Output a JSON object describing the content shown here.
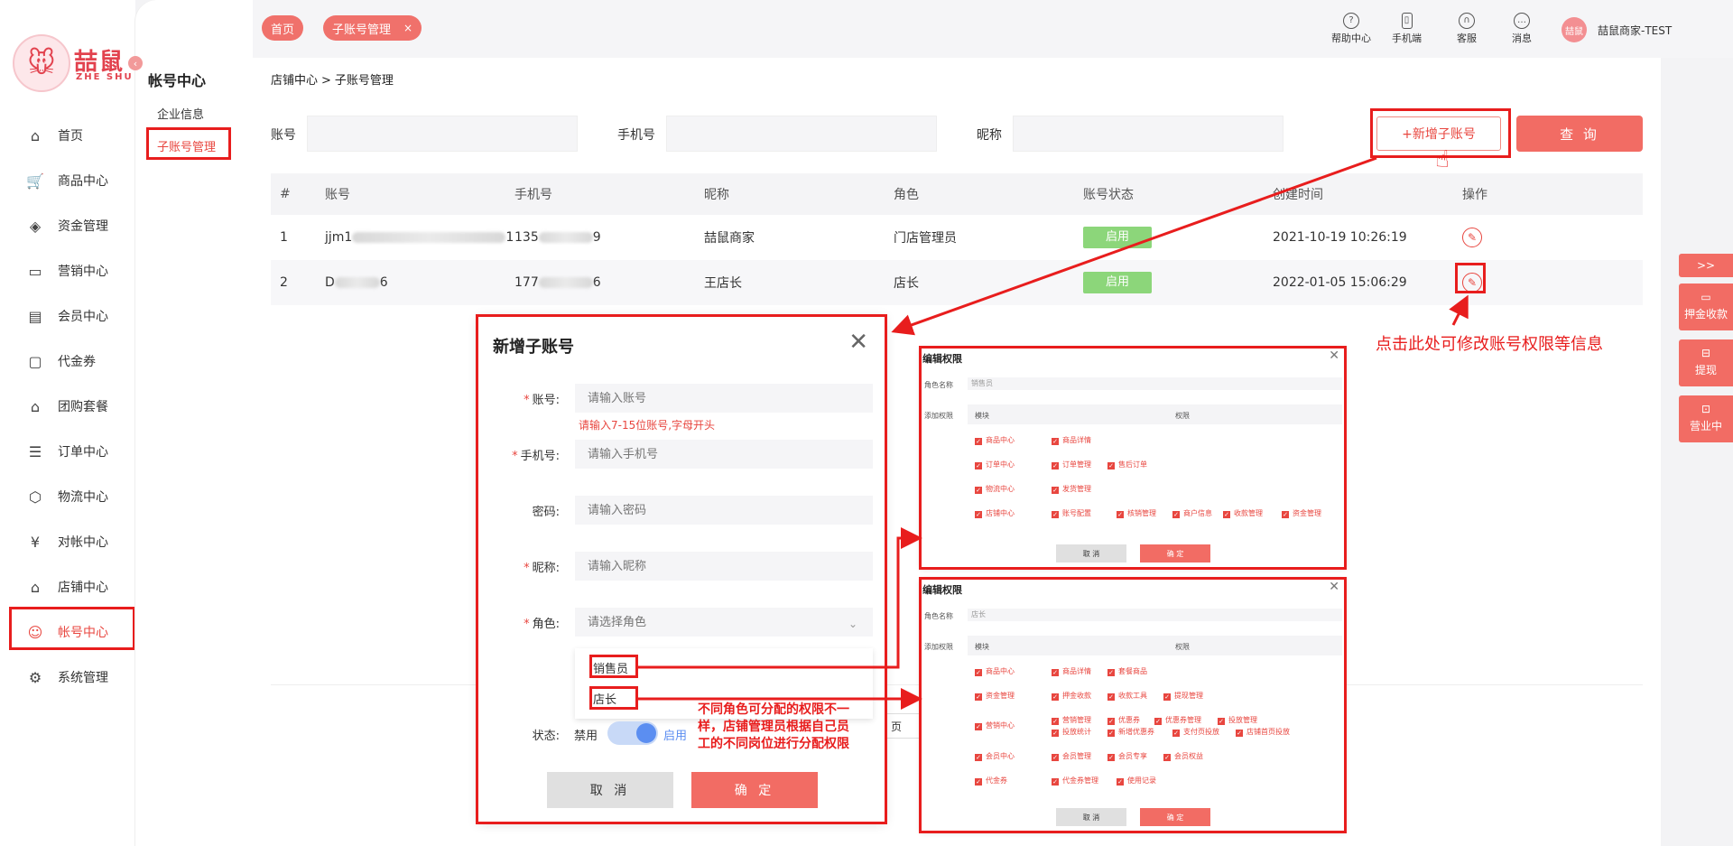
{
  "brand": {
    "logo_text": "喆鼠",
    "logo_sub": "ZHE SHU",
    "logo_icon": "mouse-mascot-icon"
  },
  "nav": [
    {
      "label": "首页",
      "icon": "home-icon"
    },
    {
      "label": "商品中心",
      "icon": "cart-icon"
    },
    {
      "label": "资金管理",
      "icon": "layers-icon"
    },
    {
      "label": "营销中心",
      "icon": "megaphone-icon"
    },
    {
      "label": "会员中心",
      "icon": "vip-card-icon"
    },
    {
      "label": "代金券",
      "icon": "coupon-icon"
    },
    {
      "label": "团购套餐",
      "icon": "tag-icon"
    },
    {
      "label": "订单中心",
      "icon": "order-icon"
    },
    {
      "label": "物流中心",
      "icon": "box-icon"
    },
    {
      "label": "对帐中心",
      "icon": "yen-icon"
    },
    {
      "label": "店铺中心",
      "icon": "store-icon"
    },
    {
      "label": "帐号中心",
      "icon": "user-icon"
    },
    {
      "label": "系统管理",
      "icon": "settings-icon"
    }
  ],
  "subnav": {
    "title": "帐号中心",
    "items": [
      "企业信息",
      "子账号管理"
    ]
  },
  "header": {
    "tabs": [
      "首页",
      "子账号管理"
    ],
    "tab_close": "×",
    "actions": [
      {
        "label": "帮助中心",
        "icon": "help-icon"
      },
      {
        "label": "手机端",
        "icon": "phone-icon"
      },
      {
        "label": "客服",
        "icon": "headset-icon"
      },
      {
        "label": "消息",
        "icon": "message-icon"
      }
    ],
    "avatar_text": "喆鼠",
    "user_name": "喆鼠商家-TEST"
  },
  "breadcrumb": {
    "parent": "店铺中心",
    "sep": ">",
    "current": "子账号管理"
  },
  "filters": {
    "account_label": "账号",
    "phone_label": "手机号",
    "nickname_label": "昵称",
    "add_button": "+新增子账号",
    "query_button": "查 询"
  },
  "table": {
    "columns": [
      "#",
      "账号",
      "手机号",
      "昵称",
      "角色",
      "账号状态",
      "创建时间",
      "操作"
    ],
    "rows": [
      {
        "index": "1",
        "account_pre": "jjm1",
        "account_post": "1",
        "phone_pre": "135",
        "phone_post": "9",
        "nickname": "喆鼠商家",
        "role": "门店管理员",
        "status": "启用",
        "created": "2021-10-19 10:26:19"
      },
      {
        "index": "2",
        "account_pre": "D",
        "account_post": "6",
        "phone_pre": "177",
        "phone_post": "6",
        "nickname": "王店长",
        "role": "店长",
        "status": "启用",
        "created": "2022-01-05 15:06:29"
      }
    ],
    "edit_icon": "edit-pen-icon"
  },
  "floating": {
    "toggle": ">>",
    "items": [
      {
        "label": "押金收款",
        "icon": "card-icon"
      },
      {
        "label": "提现",
        "icon": "withdraw-icon"
      },
      {
        "label": "营业中",
        "icon": "shop-open-icon"
      }
    ]
  },
  "modal": {
    "title": "新增子账号",
    "fields": {
      "account": {
        "label": "账号:",
        "placeholder": "请输入账号",
        "hint": "请输入7-15位账号,字母开头"
      },
      "phone": {
        "label": "手机号:",
        "placeholder": "请输入手机号"
      },
      "password": {
        "label": "密码:",
        "placeholder": "请输入密码"
      },
      "nickname": {
        "label": "昵称:",
        "placeholder": "请输入昵称"
      },
      "role": {
        "label": "角色:",
        "placeholder": "请选择角色",
        "options": [
          "销售员",
          "店长"
        ]
      },
      "status": {
        "label": "状态:",
        "off": "禁用",
        "on": "启用"
      }
    },
    "cancel": "取 消",
    "ok": "确 定",
    "page_suffix": "页"
  },
  "perm_panel_1": {
    "title": "编辑权限",
    "role_name_label": "角色名称",
    "role_name_value": "销售员",
    "perm_label": "添加权限",
    "col_module": "模块",
    "col_perm": "权限",
    "rows": [
      {
        "module": "商品中心",
        "perms": [
          "商品详情"
        ]
      },
      {
        "module": "订单中心",
        "perms": [
          "订单管理",
          "售后订单"
        ]
      },
      {
        "module": "物流中心",
        "perms": [
          "发货管理"
        ]
      },
      {
        "module": "店铺中心",
        "perms": [
          "账号配置",
          "核销管理",
          "商户信息",
          "收款管理",
          "资金管理"
        ]
      }
    ],
    "cancel": "取 消",
    "ok": "确 定"
  },
  "perm_panel_2": {
    "title": "编辑权限",
    "role_name_label": "角色名称",
    "role_name_value": "店长",
    "perm_label": "添加权限",
    "col_module": "模块",
    "col_perm": "权限",
    "rows": [
      {
        "module": "商品中心",
        "perms": [
          "商品详情",
          "套餐商品"
        ]
      },
      {
        "module": "资金管理",
        "perms": [
          "押金收款",
          "收款工具",
          "提现管理"
        ]
      },
      {
        "module": "营销中心",
        "perms": [
          "营销管理",
          "优惠券",
          "优惠券管理",
          "投放管理",
          "投放统计",
          "新增优惠券",
          "支付页投放",
          "店铺首页投放"
        ]
      },
      {
        "module": "会员中心",
        "perms": [
          "会员管理",
          "会员专享",
          "会员权益"
        ]
      },
      {
        "module": "代金券",
        "perms": [
          "代金券管理",
          "使用记录"
        ]
      }
    ],
    "cancel": "取 消",
    "ok": "确 定"
  },
  "annotations": {
    "edit_hint": "点击此处可修改账号权限等信息",
    "role_hint_1": "不同角色可分配的权限不一",
    "role_hint_2": "样，店铺管理员根据自己员",
    "role_hint_3": "工的不同岗位进行分配权限"
  },
  "colors": {
    "accent": "#f26c64",
    "annotation": "#e81d1d",
    "status_green": "#8cd67a"
  }
}
